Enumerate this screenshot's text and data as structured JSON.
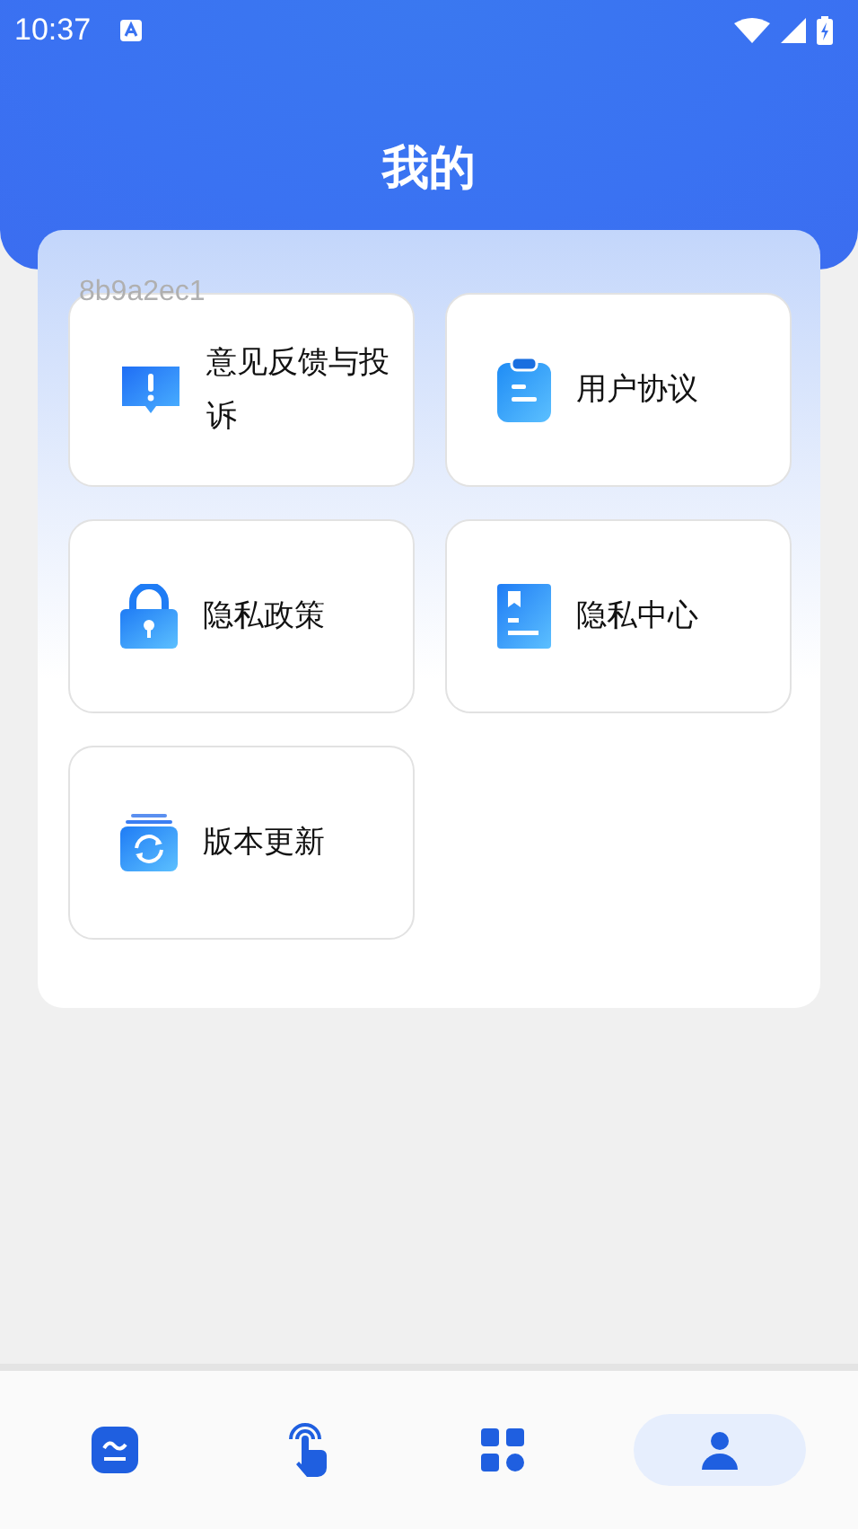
{
  "status_bar": {
    "time": "10:37"
  },
  "header": {
    "title": "我的"
  },
  "debug_label": "8b9a2ec1",
  "menu": [
    {
      "kind": "feedback",
      "label": "意见反馈与投诉"
    },
    {
      "kind": "agreement",
      "label": "用户协议"
    },
    {
      "kind": "privacy_policy",
      "label": "隐私政策"
    },
    {
      "kind": "privacy_center",
      "label": "隐私中心"
    },
    {
      "kind": "update",
      "label": "版本更新"
    }
  ],
  "bottom_nav": [
    {
      "kind": "home",
      "selected": false
    },
    {
      "kind": "tap",
      "selected": false
    },
    {
      "kind": "grid",
      "selected": false
    },
    {
      "kind": "mine",
      "selected": true
    }
  ]
}
